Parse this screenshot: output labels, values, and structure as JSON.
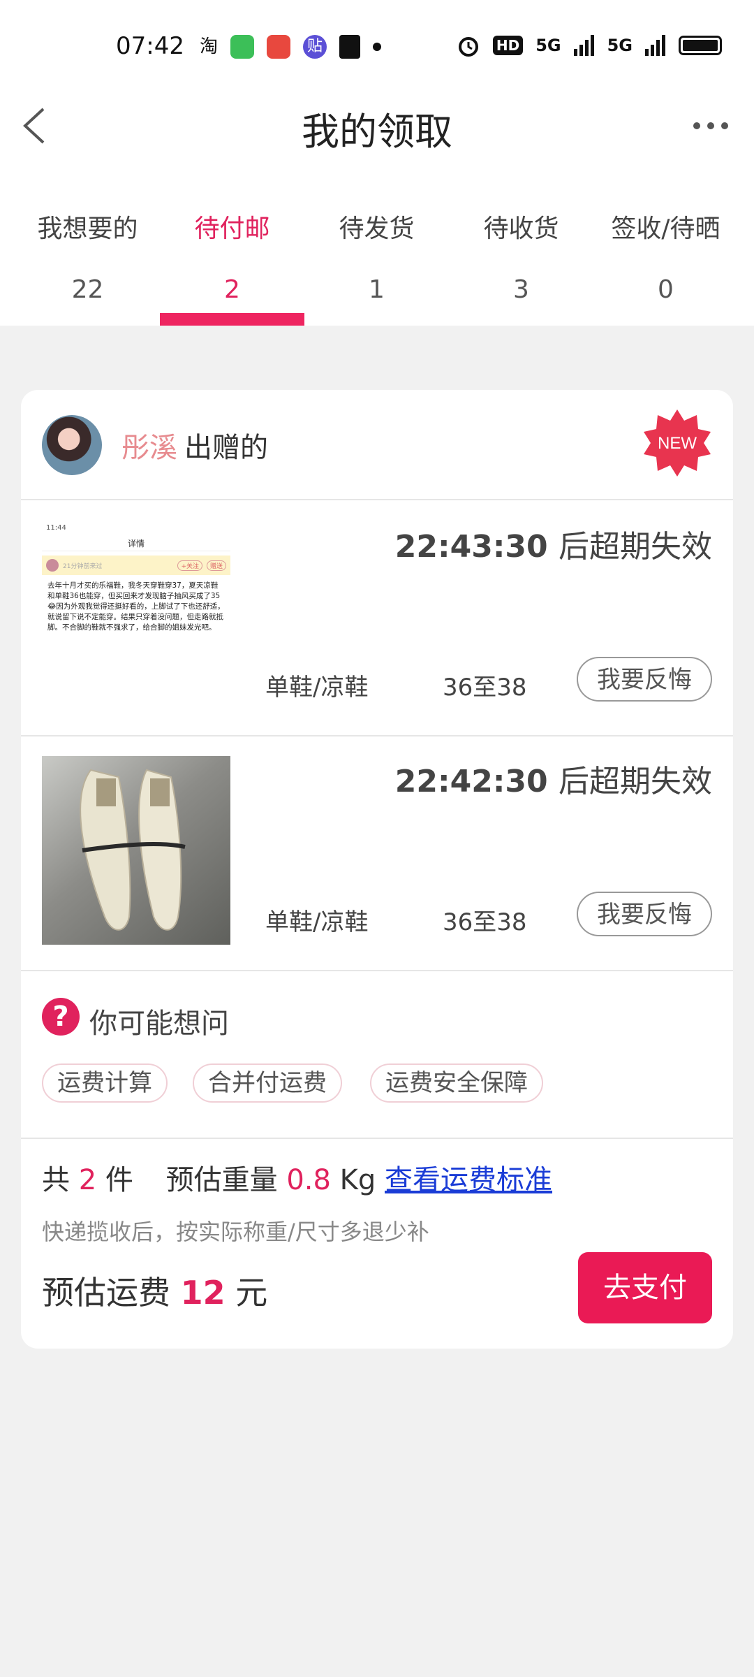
{
  "status_bar": {
    "time": "07:42",
    "notification_icons": [
      "taobao-icon",
      "message-icon",
      "app-icon",
      "tieba-icon",
      "gift-icon"
    ],
    "indicators": [
      "alarm-icon",
      "HD",
      "5G",
      "5G"
    ],
    "hd_label": "HD",
    "signal_1": "5G",
    "signal_2": "5G"
  },
  "header": {
    "title": "我的领取"
  },
  "tabs": [
    {
      "label": "我想要的",
      "count": "22"
    },
    {
      "label": "待付邮",
      "count": "2"
    },
    {
      "label": "待发货",
      "count": "1"
    },
    {
      "label": "待收货",
      "count": "3"
    },
    {
      "label": "签收/待晒",
      "count": "0"
    }
  ],
  "active_tab": 1,
  "card": {
    "giver_name": "彤溪",
    "giver_suffix": "出赠的",
    "badge": "NEW",
    "items": [
      {
        "expire_time": "22:43:30",
        "expire_suffix": "后超期失效",
        "category": "单鞋/凉鞋",
        "size": "36至38",
        "regret_label": "我要反悔",
        "thumb_header": "详情",
        "thumb_status": "11:44",
        "thumb_text": "去年十月才买的乐福鞋，我冬天穿鞋穿37，夏天凉鞋和单鞋36也能穿，但买回来才发现脑子抽风买成了35😂因为外观我觉得还挺好看的，上脚试了下也还舒适，就说留下说不定能穿。结果只穿着没问题，但走路就抵脚。不合脚的鞋就不强求了，给合脚的姐妹发光吧。",
        "thumb_user_meta": "21分钟前来过",
        "thumb_follow": "+关注",
        "thumb_gift": "赠送"
      },
      {
        "expire_time": "22:42:30",
        "expire_suffix": "后超期失效",
        "category": "单鞋/凉鞋",
        "size": "36至38",
        "regret_label": "我要反悔"
      }
    ],
    "faq": {
      "icon": "?",
      "title": "你可能想问",
      "chips": [
        "运费计算",
        "合并付运费",
        "运费安全保障"
      ]
    },
    "summary": {
      "count_prefix": "共",
      "count": "2",
      "count_suffix": "件",
      "weight_label": "预估重量",
      "weight": "0.8",
      "weight_unit": "Kg",
      "link": "查看运费标准",
      "note": "快递揽收后，按实际称重/尺寸多退少补",
      "fee_label": "预估运费",
      "fee": "12",
      "fee_unit": "元",
      "pay_label": "去支付"
    }
  },
  "colors": {
    "accent": "#e0225d",
    "pay_button": "#ea1a55",
    "link": "#1a3cd6",
    "giver_name": "#e78b8f"
  }
}
